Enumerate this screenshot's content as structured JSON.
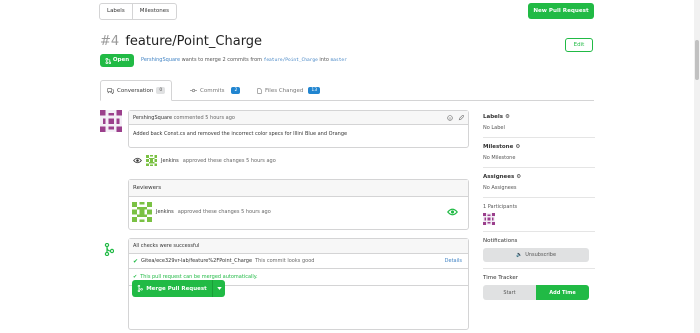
{
  "toolbar": {
    "labels": "Labels",
    "milestones": "Milestones",
    "new_pr": "New Pull Request"
  },
  "pr": {
    "number": "#4",
    "title": "feature/Point_Charge",
    "edit": "Edit",
    "status": "Open",
    "author": "PershingSquare",
    "merge_text": "wants to merge 2 commits from",
    "head_branch": "feature/Point_Charge",
    "into": "into",
    "base_branch": "master"
  },
  "tabs": {
    "conversation": "Conversation",
    "conversation_count": "0",
    "commits": "Commits",
    "commits_count": "2",
    "files": "Files Changed",
    "files_count": "13"
  },
  "comment": {
    "author": "PershingSquare",
    "meta": "commented 5 hours ago",
    "body": "Added back Const.cs and removed the incorrect color specs for Illini Blue and Orange"
  },
  "event": {
    "user": "Jenkins",
    "text": "approved these changes 5 hours ago"
  },
  "reviewers": {
    "title": "Reviewers",
    "user": "Jenkins",
    "text": "approved these changes 5 hours ago"
  },
  "checks": {
    "header": "All checks were successful",
    "context": "Gitea/ece329vr-lab/feature%2FPoint_Charge",
    "desc": "This commit looks good",
    "details": "Details",
    "auto": "This pull request can be merged automatically.",
    "merge_btn": "Merge Pull Request"
  },
  "sidebar": {
    "labels_title": "Labels",
    "labels_value": "No Label",
    "milestone_title": "Milestone",
    "milestone_value": "No Milestone",
    "assignees_title": "Assignees",
    "assignees_value": "No Assignees",
    "participants": "1 Participants",
    "notifications_title": "Notifications",
    "unsubscribe": "Unsubscribe",
    "tracker_title": "Time Tracker",
    "start": "Start",
    "add_time": "Add Time"
  },
  "colors": {
    "green": "#21ba45",
    "blue": "#2185d0",
    "link": "#4183c4"
  }
}
